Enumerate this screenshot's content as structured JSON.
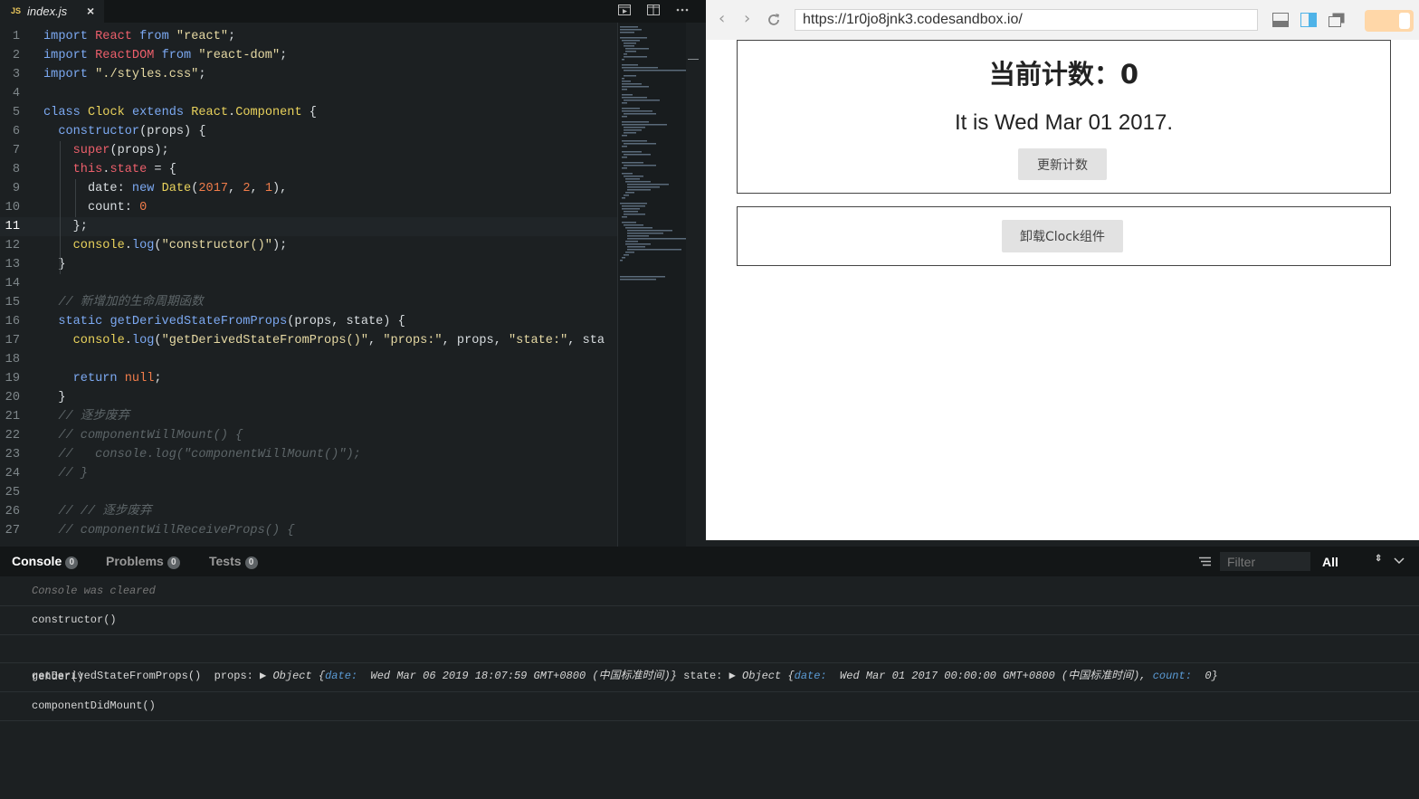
{
  "editor": {
    "tab": {
      "lang_badge": "JS",
      "filename": "index.js",
      "close_glyph": "×"
    },
    "lines": [
      {
        "n": "1",
        "html": "<span class=\"kw\">import</span> <span class=\"th\">React</span> <span class=\"kw\">from</span> <span class=\"str\">\"react\"</span>;"
      },
      {
        "n": "2",
        "html": "<span class=\"kw\">import</span> <span class=\"th\">ReactDOM</span> <span class=\"kw\">from</span> <span class=\"str\">\"react-dom\"</span>;"
      },
      {
        "n": "3",
        "html": "<span class=\"kw\">import</span> <span class=\"str\">\"./styles.css\"</span>;"
      },
      {
        "n": "4",
        "html": ""
      },
      {
        "n": "5",
        "html": "<span class=\"kw\">class</span> <span class=\"cls\">Clock</span> <span class=\"kw\">extends</span> <span class=\"cls\">React</span>.<span class=\"cls\">Component</span> {"
      },
      {
        "n": "6",
        "html": "  <span class=\"fn\">constructor</span>(props) {"
      },
      {
        "n": "7",
        "html": "    <span class=\"th\">super</span>(props);"
      },
      {
        "n": "8",
        "html": "    <span class=\"th\">this</span>.<span class=\"th\">state</span> = {"
      },
      {
        "n": "9",
        "html": "      date: <span class=\"kw\">new</span> <span class=\"cls\">Date</span>(<span class=\"num\">2017</span>, <span class=\"num\">2</span>, <span class=\"num\">1</span>),"
      },
      {
        "n": "10",
        "html": "      count: <span class=\"num\">0</span>"
      },
      {
        "n": "11",
        "html": "    };"
      },
      {
        "n": "12",
        "html": "    <span class=\"cls\">console</span>.<span class=\"fn\">log</span>(<span class=\"str\">\"constructor()\"</span>);"
      },
      {
        "n": "13",
        "html": "  }"
      },
      {
        "n": "14",
        "html": ""
      },
      {
        "n": "15",
        "html": "  <span class=\"cmt\">// 新增加的生命周期函数</span>"
      },
      {
        "n": "16",
        "html": "  <span class=\"kw\">static</span> <span class=\"fn\">getDerivedStateFromProps</span>(props, state) {"
      },
      {
        "n": "17",
        "html": "    <span class=\"cls\">console</span>.<span class=\"fn\">log</span>(<span class=\"str\">\"getDerivedStateFromProps()\"</span>, <span class=\"str\">\"props:\"</span>, props, <span class=\"str\">\"state:\"</span>, sta"
      },
      {
        "n": "18",
        "html": ""
      },
      {
        "n": "19",
        "html": "    <span class=\"kw\">return</span> <span class=\"num\">null</span>;"
      },
      {
        "n": "20",
        "html": "  }"
      },
      {
        "n": "21",
        "html": "  <span class=\"cmt\">// 逐步废弃</span>"
      },
      {
        "n": "22",
        "html": "  <span class=\"cmt\">// componentWillMount() {</span>"
      },
      {
        "n": "23",
        "html": "  <span class=\"cmt\">//   console.log(\"componentWillMount()\");</span>"
      },
      {
        "n": "24",
        "html": "  <span class=\"cmt\">// }</span>"
      },
      {
        "n": "25",
        "html": ""
      },
      {
        "n": "26",
        "html": "  <span class=\"cmt\">// // 逐步废弃</span>"
      },
      {
        "n": "27",
        "html": "  <span class=\"cmt\">// componentWillReceiveProps() {</span>"
      }
    ],
    "active_line": "11"
  },
  "browser": {
    "url": "https://1r0jo8jnk3.codesandbox.io/",
    "count_heading": "当前计数：0",
    "date_heading": "It is Wed Mar 01 2017.",
    "update_button": "更新计数",
    "unmount_button": "卸载Clock组件"
  },
  "console": {
    "tabs": [
      {
        "label": "Console",
        "count": "0"
      },
      {
        "label": "Problems",
        "count": "0"
      },
      {
        "label": "Tests",
        "count": "0"
      }
    ],
    "filter_placeholder": "Filter",
    "level": "All",
    "rows": [
      {
        "type": "cleared",
        "text": "Console was cleared"
      },
      {
        "type": "plain",
        "text": "constructor()"
      },
      {
        "type": "gdsfp",
        "prefix": "getDerivedStateFromProps()  props: ",
        "props_obj": "▶ Object {",
        "props_key": "date:",
        "props_val": "  Wed Mar 06 2019 18:07:59 GMT+0800 (中国标准时间)}",
        "state_label": " state: ",
        "state_obj": "▶ Object {",
        "state_key1": "date:",
        "state_val1": "  Wed Mar 01 2017 00:00:00 GMT+0800 (中国标准时间),",
        "state_key2": " count:",
        "state_val2": "  0}"
      },
      {
        "type": "plain",
        "text": "render()"
      },
      {
        "type": "plain",
        "text": "componentDidMount()"
      }
    ]
  }
}
